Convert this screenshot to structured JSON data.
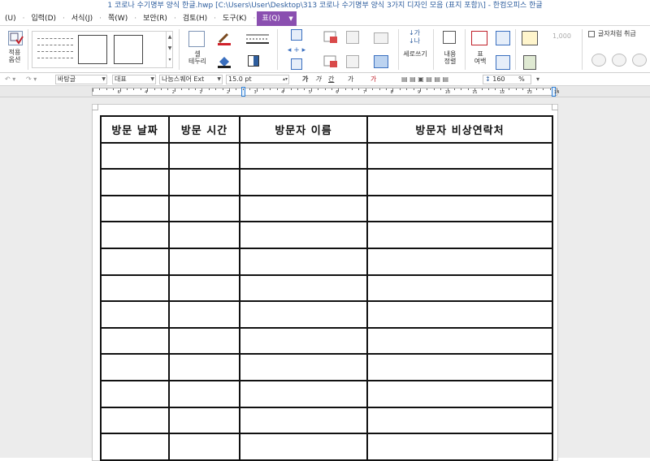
{
  "window": {
    "title": "1 코로나 수기명부 양식 한글.hwp [C:\\Users\\User\\Desktop\\313 코로나 수기명부 양식 3가지 디자인 모음 (표지 포함)\\] - 한컴오피스 한글"
  },
  "menu": {
    "items": [
      "(U)",
      "입력(D)",
      "서식(J)",
      "쪽(W)",
      "보안(R)",
      "검토(H)",
      "도구(K)"
    ],
    "active": "표(Q)"
  },
  "ribbon": {
    "apply_label": "적용\n옵션",
    "cell_border_label": "셀\n테두리",
    "vertical_write_label": "세로쓰기",
    "content_align_label": "내용\n정렬",
    "table_margin_label": "표\n여백",
    "number_value": "1,000",
    "treat_as_char_label": "글자처럼 취급"
  },
  "format_bar": {
    "style": "바탕글",
    "lang": "대표",
    "font": "나눔스퀘어 Ext",
    "size": "15.0",
    "unit": "pt",
    "char_buttons": [
      "가",
      "가",
      "간",
      "가",
      "가"
    ],
    "line_spacing": "160",
    "percent": "%"
  },
  "ruler": {
    "numbers": [
      "6",
      "4",
      "2",
      "1",
      "2",
      "3",
      "4",
      "5",
      "6",
      "7",
      "8",
      "9",
      "10",
      "11",
      "12",
      "13",
      "14"
    ]
  },
  "document": {
    "headers": [
      "방문 날짜",
      "방문 시간",
      "방문자 이름",
      "방문자 비상연락처"
    ],
    "row_count": 12
  }
}
